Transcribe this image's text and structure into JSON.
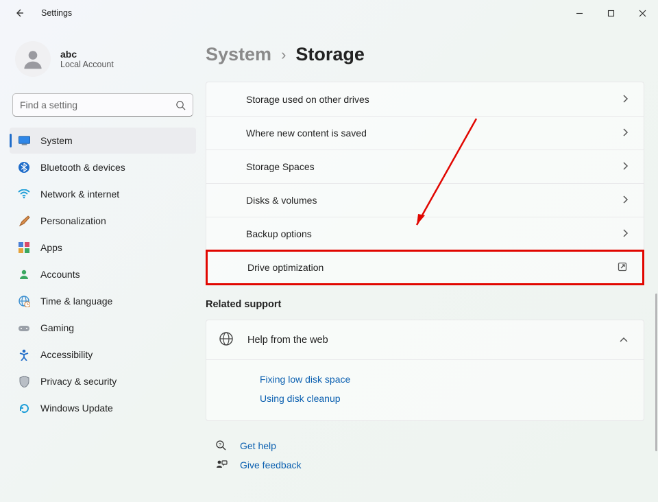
{
  "app_title": "Settings",
  "window_controls": {
    "min": "minimize",
    "max": "maximize",
    "close": "close"
  },
  "user": {
    "name": "abc",
    "subtitle": "Local Account"
  },
  "search": {
    "placeholder": "Find a setting"
  },
  "sidebar": {
    "items": [
      {
        "label": "System",
        "icon": "monitor-icon",
        "active": true
      },
      {
        "label": "Bluetooth & devices",
        "icon": "bluetooth-icon",
        "active": false
      },
      {
        "label": "Network & internet",
        "icon": "wifi-icon",
        "active": false
      },
      {
        "label": "Personalization",
        "icon": "brush-icon",
        "active": false
      },
      {
        "label": "Apps",
        "icon": "apps-icon",
        "active": false
      },
      {
        "label": "Accounts",
        "icon": "person-icon",
        "active": false
      },
      {
        "label": "Time & language",
        "icon": "globe-clock-icon",
        "active": false
      },
      {
        "label": "Gaming",
        "icon": "gamepad-icon",
        "active": false
      },
      {
        "label": "Accessibility",
        "icon": "accessibility-icon",
        "active": false
      },
      {
        "label": "Privacy & security",
        "icon": "shield-icon",
        "active": false
      },
      {
        "label": "Windows Update",
        "icon": "update-icon",
        "active": false
      }
    ]
  },
  "breadcrumb": {
    "parent": "System",
    "current": "Storage"
  },
  "storage_rows": [
    {
      "label": "Storage used on other drives",
      "action": "chevron"
    },
    {
      "label": "Where new content is saved",
      "action": "chevron"
    },
    {
      "label": "Storage Spaces",
      "action": "chevron"
    },
    {
      "label": "Disks & volumes",
      "action": "chevron"
    },
    {
      "label": "Backup options",
      "action": "chevron"
    },
    {
      "label": "Drive optimization",
      "action": "external",
      "highlight": true
    }
  ],
  "related_title": "Related support",
  "help_card": {
    "title": "Help from the web",
    "links": [
      {
        "label": "Fixing low disk space"
      },
      {
        "label": "Using disk cleanup"
      }
    ]
  },
  "footer_links": [
    {
      "label": "Get help",
      "icon": "help-icon"
    },
    {
      "label": "Give feedback",
      "icon": "feedback-icon"
    }
  ]
}
